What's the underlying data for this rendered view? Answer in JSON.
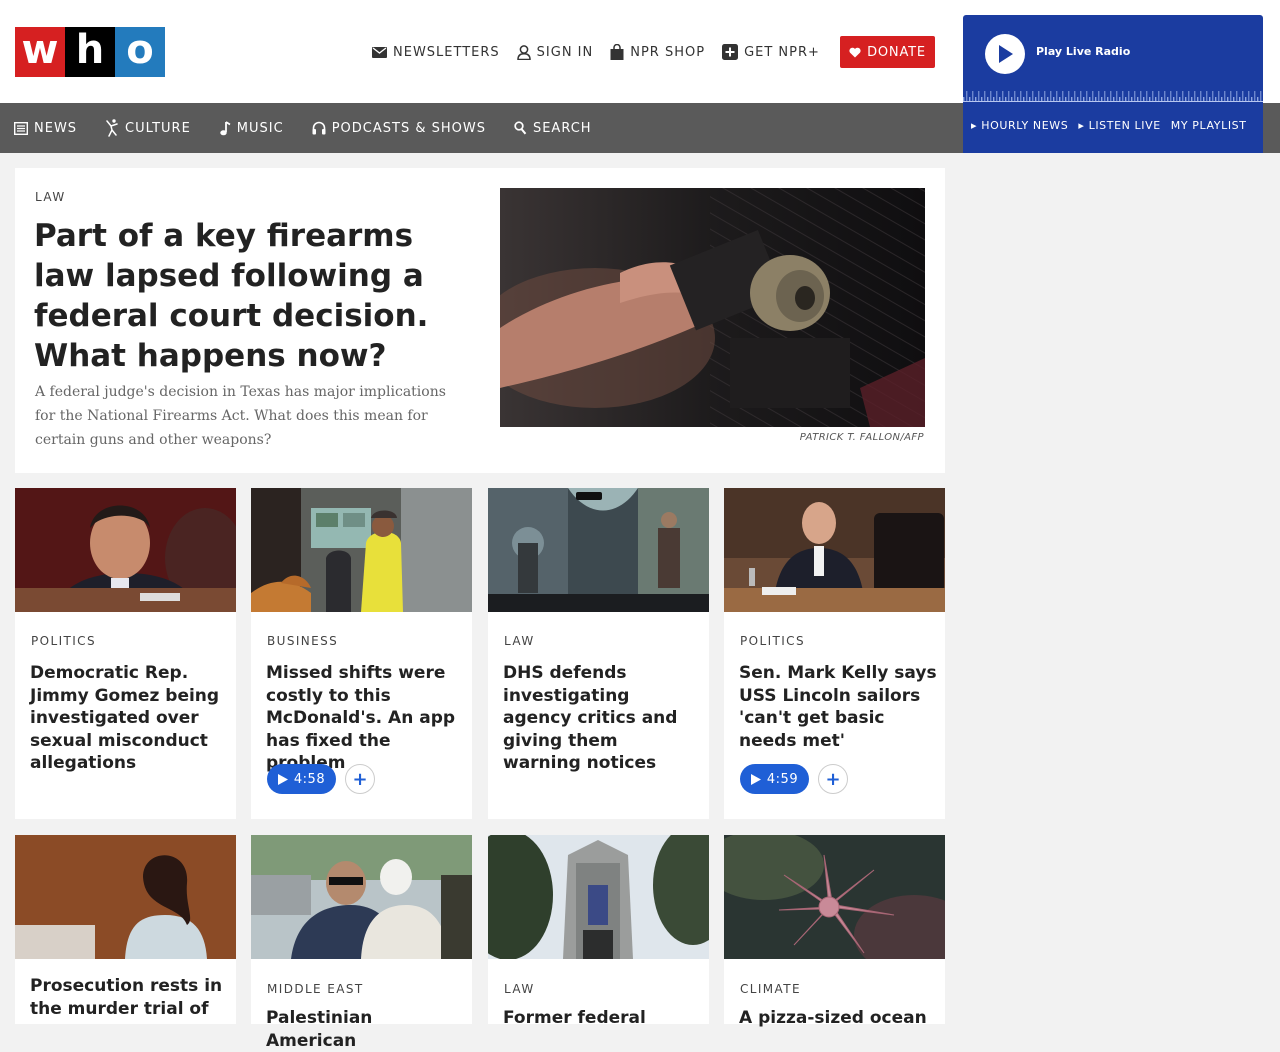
{
  "header": {
    "logo_letters": [
      "w",
      "h",
      "o"
    ],
    "utilities": [
      "NEWSLETTERS",
      "SIGN IN",
      "NPR SHOP",
      "GET NPR+"
    ],
    "donate_label": "DONATE"
  },
  "player": {
    "play_label": "Play Live Radio",
    "links": [
      "▸ HOURLY NEWS",
      "▸ LISTEN LIVE",
      "MY PLAYLIST"
    ]
  },
  "nav": {
    "items": [
      "NEWS",
      "CULTURE",
      "MUSIC",
      "PODCASTS & SHOWS",
      "SEARCH"
    ]
  },
  "hero": {
    "slug": "LAW",
    "title": "Part of a key firearms law lapsed following a federal court decision. What happens now?",
    "teaser": "A federal judge's decision in Texas has major implications for the National Firearms Act. What does this mean for certain guns and other weapons?",
    "credit": "PATRICK T. FALLON/AFP"
  },
  "cards_row1": [
    {
      "slug": "POLITICS",
      "title": "Democratic Rep. Jimmy Gomez being investigated over sexual misconduct allegations"
    },
    {
      "slug": "BUSINESS",
      "title": "Missed shifts were costly to this McDonald's. An app has fixed the problem",
      "duration": "4:58"
    },
    {
      "slug": "LAW",
      "title": "DHS defends investigating agency critics and giving them warning notices"
    },
    {
      "slug": "POLITICS",
      "title": "Sen. Mark Kelly says USS Lincoln sailors 'can't get basic needs met'",
      "duration": "4:59"
    }
  ],
  "cards_row2": [
    {
      "slug": "",
      "title": "Prosecution rests in the murder trial of"
    },
    {
      "slug": "MIDDLE EAST",
      "title": "Palestinian American"
    },
    {
      "slug": "LAW",
      "title": "Former federal"
    },
    {
      "slug": "CLIMATE",
      "title": "A pizza-sized ocean"
    }
  ],
  "add_symbol": "+",
  "colors": {
    "accent_red": "#d62021",
    "player_blue": "#1b3ca0",
    "nav_gray": "#5a5a5a",
    "audio_blue": "#1f5fd6"
  }
}
